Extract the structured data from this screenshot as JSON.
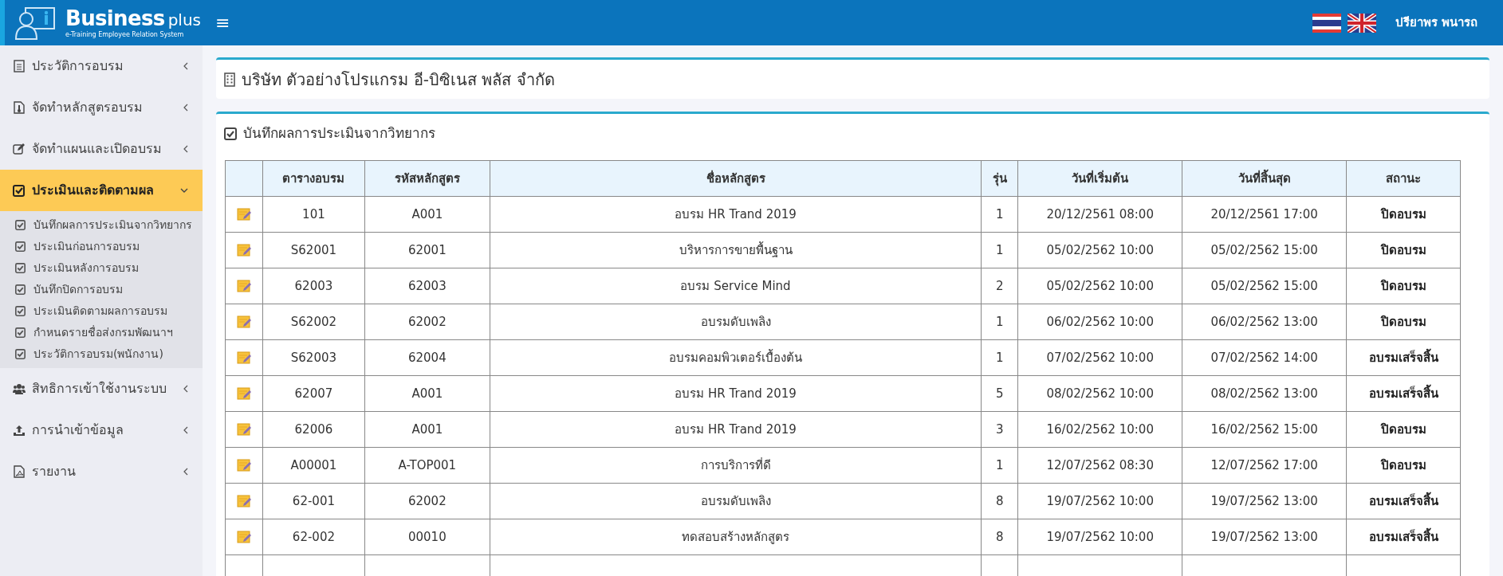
{
  "header": {
    "logo_title": "Business",
    "logo_suffix": "plus",
    "logo_subtitle": "e-Training Employee Relation System",
    "menu_toggle": "≡",
    "user_name": "ปรียาพร พนารถ"
  },
  "sidebar": {
    "items": [
      {
        "label": "ประวัติการอบรม",
        "expanded": false,
        "selected": false
      },
      {
        "label": "จัดทำหลักสูตรอบรม",
        "expanded": false,
        "selected": false
      },
      {
        "label": "จัดทำแผนและเปิดอบรม",
        "expanded": false,
        "selected": false
      },
      {
        "label": "ประเมินและติดตามผล",
        "expanded": true,
        "selected": true,
        "children": [
          {
            "label": "บันทึกผลการประเมินจากวิทยากร"
          },
          {
            "label": "ประเมินก่อนการอบรม"
          },
          {
            "label": "ประเมินหลังการอบรม"
          },
          {
            "label": "บันทึกปิดการอบรม"
          },
          {
            "label": "ประเมินติดตามผลการอบรม"
          },
          {
            "label": "กำหนดรายชื่อส่งกรมพัฒนาฯ"
          },
          {
            "label": "ประวัติการอบรม(พนักงาน)"
          }
        ]
      },
      {
        "label": "สิทธิการเข้าใช้งานระบบ",
        "expanded": false,
        "selected": false
      },
      {
        "label": "การนำเข้าข้อมูล",
        "expanded": false,
        "selected": false
      },
      {
        "label": "รายงาน",
        "expanded": false,
        "selected": false
      }
    ]
  },
  "company": {
    "title": "บริษัท ตัวอย่างโปรแกรม อี-บิซิเนส พลัส จำกัด"
  },
  "panel": {
    "title": "บันทึกผลการประเมินจากวิทยากร"
  },
  "table": {
    "columns": [
      "ตารางอบรม",
      "รหัสหลักสูตร",
      "ชื่อหลักสูตร",
      "รุ่น",
      "วันที่เริ่มต้น",
      "วันที่สิ้นสุด",
      "สถานะ"
    ],
    "rows": [
      [
        "101",
        "A001",
        "อบรม HR Trand 2019",
        "1",
        "20/12/2561 08:00",
        "20/12/2561 17:00",
        "ปิดอบรม"
      ],
      [
        "S62001",
        "62001",
        "บริหารการขายพื้นฐาน",
        "1",
        "05/02/2562 10:00",
        "05/02/2562 15:00",
        "ปิดอบรม"
      ],
      [
        "62003",
        "62003",
        "อบรม Service Mind",
        "2",
        "05/02/2562 10:00",
        "05/02/2562 15:00",
        "ปิดอบรม"
      ],
      [
        "S62002",
        "62002",
        "อบรมดับเพลิง",
        "1",
        "06/02/2562 10:00",
        "06/02/2562 13:00",
        "ปิดอบรม"
      ],
      [
        "S62003",
        "62004",
        "อบรมคอมพิวเตอร์เบื้องต้น",
        "1",
        "07/02/2562 10:00",
        "07/02/2562 14:00",
        "อบรมเสร็จสิ้น"
      ],
      [
        "62007",
        "A001",
        "อบรม HR Trand 2019",
        "5",
        "08/02/2562 10:00",
        "08/02/2562 13:00",
        "อบรมเสร็จสิ้น"
      ],
      [
        "62006",
        "A001",
        "อบรม HR Trand 2019",
        "3",
        "16/02/2562 10:00",
        "16/02/2562 15:00",
        "ปิดอบรม"
      ],
      [
        "A00001",
        "A-TOP001",
        "การบริการที่ดี",
        "1",
        "12/07/2562 08:30",
        "12/07/2562 17:00",
        "ปิดอบรม"
      ],
      [
        "62-001",
        "62002",
        "อบรมดับเพลิง",
        "8",
        "19/07/2562 10:00",
        "19/07/2562 13:00",
        "อบรมเสร็จสิ้น"
      ],
      [
        "62-002",
        "00010",
        "ทดสอบสร้างหลักสูตร",
        "8",
        "19/07/2562 10:00",
        "19/07/2562 13:00",
        "อบรมเสร็จสิ้น"
      ]
    ]
  }
}
